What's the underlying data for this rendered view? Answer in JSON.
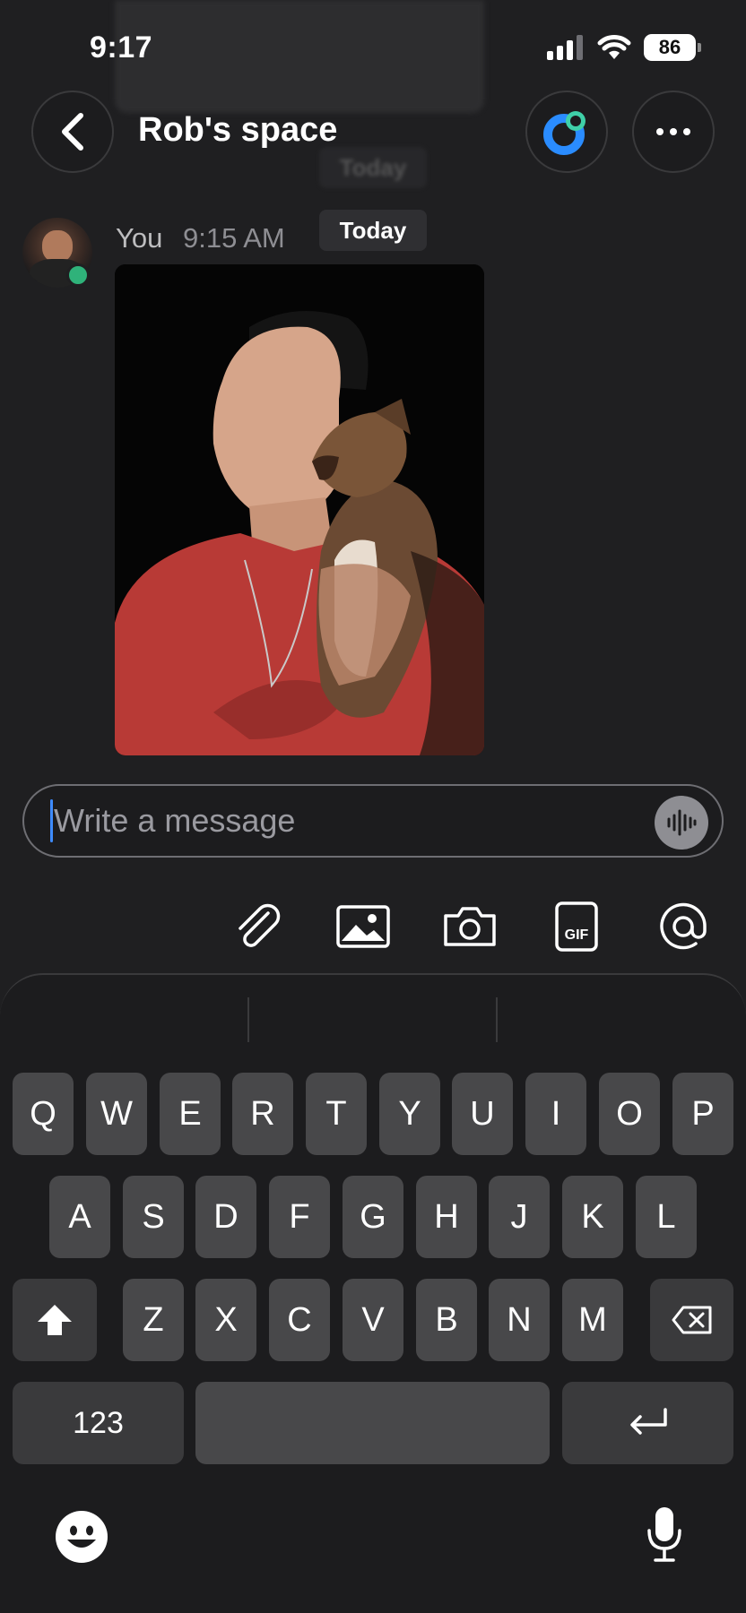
{
  "status_bar": {
    "time": "9:17",
    "battery": "86"
  },
  "header": {
    "title": "Rob's space",
    "ghost_today": "Today"
  },
  "message": {
    "author": "You",
    "time": "9:15 AM",
    "date_badge": "Today"
  },
  "composer": {
    "placeholder": "Write a message"
  },
  "keyboard": {
    "row1": [
      "Q",
      "W",
      "E",
      "R",
      "T",
      "Y",
      "U",
      "I",
      "O",
      "P"
    ],
    "row2": [
      "A",
      "S",
      "D",
      "F",
      "G",
      "H",
      "J",
      "K",
      "L"
    ],
    "row3": [
      "Z",
      "X",
      "C",
      "V",
      "B",
      "N",
      "M"
    ],
    "numbers_key": "123"
  },
  "colors": {
    "background": "#1f1f21",
    "key": "#48484a",
    "presence": "#2fb27a",
    "caret": "#3e8bff"
  }
}
